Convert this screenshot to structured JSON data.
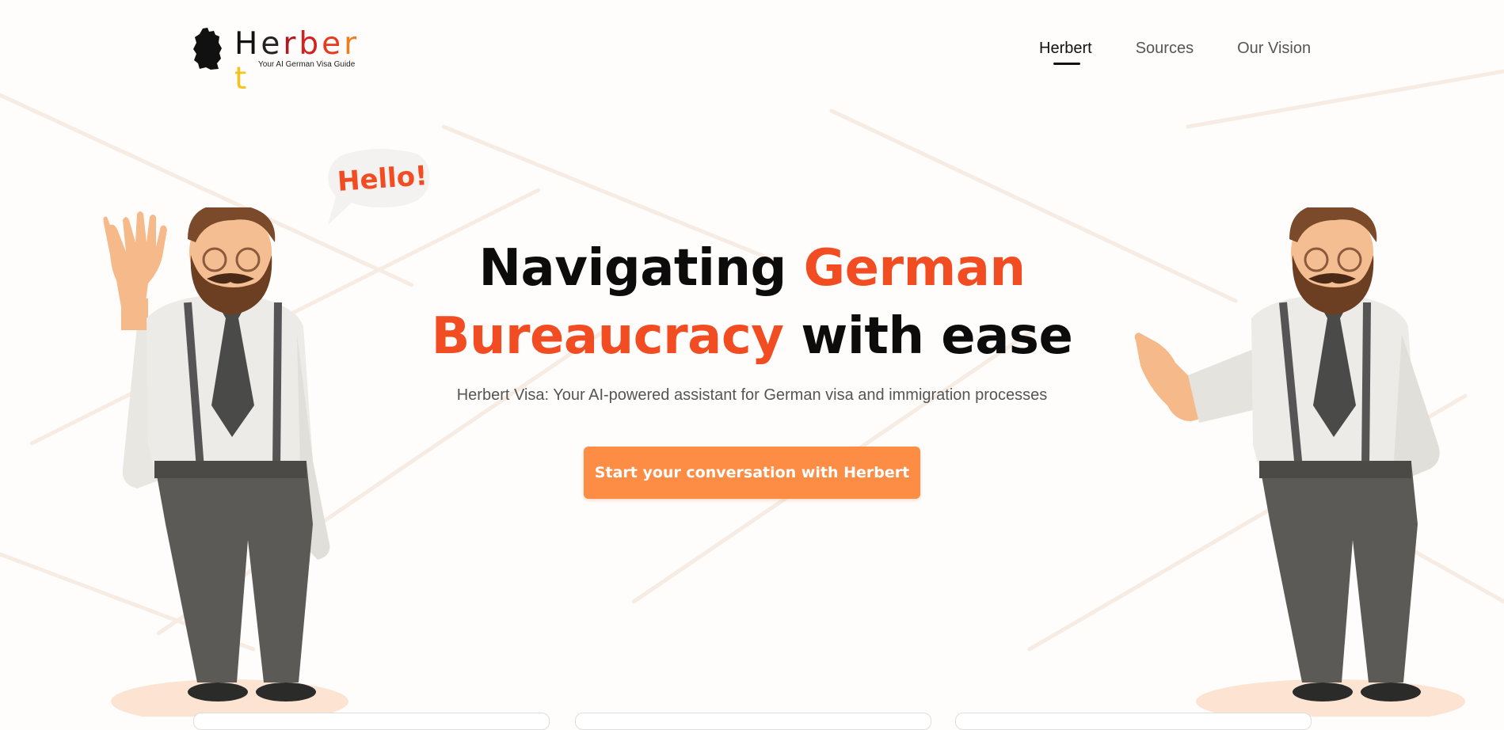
{
  "logo": {
    "name_letters": [
      {
        "ch": "H",
        "color": "#111111"
      },
      {
        "ch": "e",
        "color": "#222222"
      },
      {
        "ch": "r",
        "color": "#b3171f"
      },
      {
        "ch": "b",
        "color": "#d2211f"
      },
      {
        "ch": "e",
        "color": "#e63b1f"
      },
      {
        "ch": "r",
        "color": "#f07d1c"
      },
      {
        "ch": "t",
        "color": "#f7c21b"
      }
    ],
    "tagline": "Your AI German Visa Guide",
    "icon": "germany-map-icon"
  },
  "nav": {
    "items": [
      {
        "label": "Herbert",
        "active": true
      },
      {
        "label": "Sources",
        "active": false
      },
      {
        "label": "Our Vision",
        "active": false
      }
    ]
  },
  "hero": {
    "title_part1": "Navigating ",
    "title_accent1": "German",
    "title_accent2": "Bureaucracy",
    "title_part2": " with ease",
    "subtitle": "Herbert Visa: Your AI-powered assistant for German visa and immigration processes",
    "cta_label": "Start your conversation with Herbert"
  },
  "bubble": {
    "text": "Hello!"
  },
  "colors": {
    "accent": "#f24d22",
    "button": "#fd8c45",
    "background": "#fffdfb"
  }
}
